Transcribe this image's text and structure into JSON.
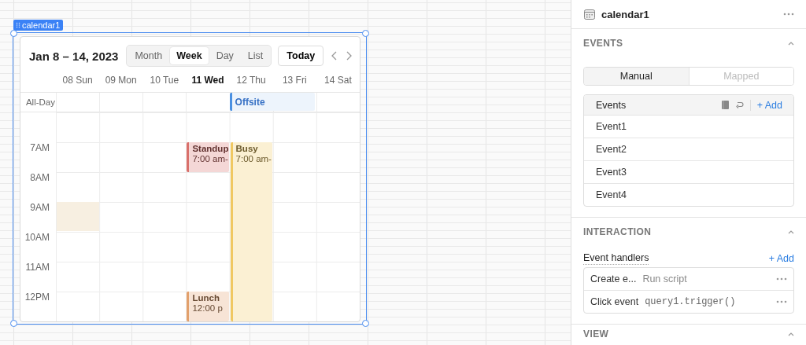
{
  "widget": {
    "name": "calendar1"
  },
  "calendar": {
    "title": "Jan 8 – 14, 2023",
    "views": [
      {
        "label": "Month",
        "selected": false
      },
      {
        "label": "Week",
        "selected": true
      },
      {
        "label": "Day",
        "selected": false
      },
      {
        "label": "List",
        "selected": false
      }
    ],
    "today_button": "Today",
    "days": [
      {
        "label": "08 Sun",
        "today": false
      },
      {
        "label": "09 Mon",
        "today": false
      },
      {
        "label": "10 Tue",
        "today": false
      },
      {
        "label": "11 Wed",
        "today": true
      },
      {
        "label": "12 Thu",
        "today": false
      },
      {
        "label": "13 Fri",
        "today": false
      },
      {
        "label": "14 Sat",
        "today": false
      }
    ],
    "all_day_label": "All-Day",
    "all_day_events": [
      {
        "title": "Offsite",
        "color": "#4a90e2"
      }
    ],
    "hours": [
      "7AM",
      "8AM",
      "9AM",
      "10AM",
      "11AM",
      "12PM"
    ],
    "events": [
      {
        "title": "Standup",
        "time": "7:00 am-",
        "color": "#d9706b"
      },
      {
        "title": "Busy",
        "time": "7:00 am-",
        "color": "#f0c862"
      },
      {
        "title": "Lunch",
        "time": "12:00 p",
        "color": "#e2a06c"
      }
    ]
  },
  "inspector": {
    "title": "calendar1",
    "events_section": {
      "heading": "EVENTS",
      "expanded": true,
      "modes": [
        {
          "label": "Manual",
          "selected": true
        },
        {
          "label": "Mapped",
          "selected": false
        }
      ],
      "list_title": "Events",
      "add": "+ Add",
      "items": [
        "Event1",
        "Event2",
        "Event3",
        "Event4"
      ]
    },
    "interaction_section": {
      "heading": "INTERACTION",
      "expanded": true,
      "handlers_label": "Event handlers",
      "add": "+ Add",
      "handlers": [
        {
          "event": "Create e...",
          "action": "Run script",
          "kind": "script"
        },
        {
          "event": "Click event",
          "action": "query1.trigger()",
          "kind": "code"
        }
      ]
    },
    "view_section": {
      "heading": "VIEW",
      "expanded": true
    }
  }
}
